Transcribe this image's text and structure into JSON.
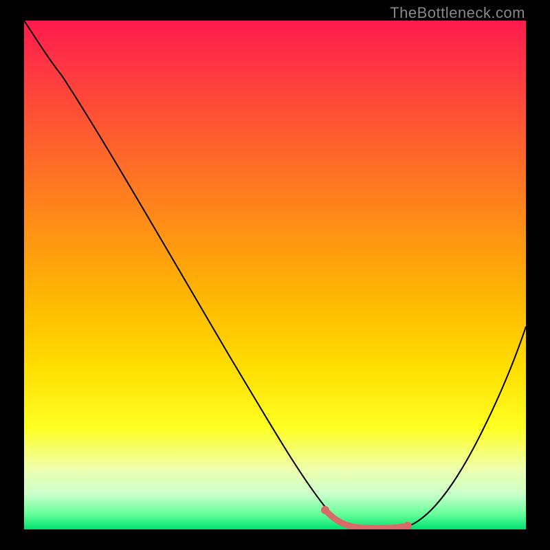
{
  "watermark": "TheBottleneck.com",
  "colors": {
    "highlight": "#d86a6a",
    "curve": "#000000",
    "frame": "#000000"
  },
  "chart_data": {
    "type": "line",
    "title": "",
    "xlabel": "",
    "ylabel": "",
    "xlim": [
      0,
      100
    ],
    "ylim": [
      0,
      100
    ],
    "x": [
      0,
      3,
      8,
      15,
      22,
      30,
      38,
      46,
      54,
      58,
      62,
      66,
      70,
      74,
      78,
      82,
      86,
      90,
      94,
      98,
      100
    ],
    "values": [
      100,
      96,
      91,
      81,
      71,
      60,
      49,
      38,
      27,
      21,
      15,
      10,
      5,
      2,
      0.5,
      0.5,
      2,
      8,
      18,
      32,
      40
    ],
    "highlight_range_x": [
      58,
      76
    ],
    "note": "Values estimated from pixel positions; y represents relative bottleneck percentage where lower is better (green)."
  }
}
